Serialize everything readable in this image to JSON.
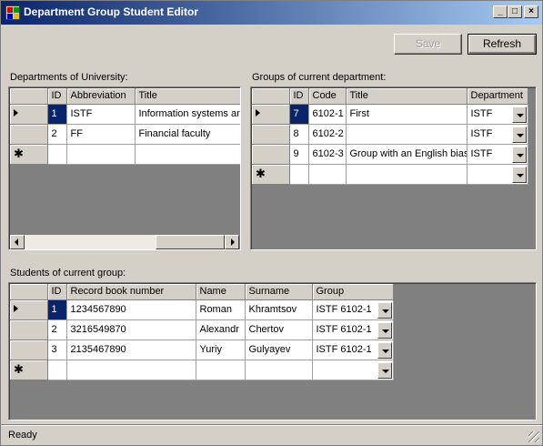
{
  "window": {
    "title": "Department Group Student Editor"
  },
  "titlebar_buttons": {
    "minimize": "_",
    "maximize": "□",
    "close": "×"
  },
  "toolbar": {
    "save_label": "Save",
    "refresh_label": "Refresh"
  },
  "departments": {
    "label": "Departments of University:",
    "columns": [
      "ID",
      "Abbreviation",
      "Title"
    ],
    "rows": [
      {
        "id": "1",
        "abbreviation": "ISTF",
        "title": "Information systems and"
      },
      {
        "id": "2",
        "abbreviation": "FF",
        "title": "Financial faculty"
      }
    ]
  },
  "groups": {
    "label": "Groups of current department:",
    "columns": [
      "ID",
      "Code",
      "Title",
      "Department"
    ],
    "rows": [
      {
        "id": "7",
        "code": "6102-1",
        "title": "First",
        "department": "ISTF"
      },
      {
        "id": "8",
        "code": "6102-2",
        "title": "",
        "department": "ISTF"
      },
      {
        "id": "9",
        "code": "6102-3",
        "title": "Group with an English bias",
        "department": "ISTF"
      }
    ]
  },
  "students": {
    "label": "Students of current group:",
    "columns": [
      "ID",
      "Record book number",
      "Name",
      "Surname",
      "Group"
    ],
    "rows": [
      {
        "id": "1",
        "record": "1234567890",
        "name": "Roman",
        "surname": "Khramtsov",
        "group": "ISTF 6102-1"
      },
      {
        "id": "2",
        "record": "3216549870",
        "name": "Alexandr",
        "surname": "Chertov",
        "group": "ISTF 6102-1"
      },
      {
        "id": "3",
        "record": "2135467890",
        "name": "Yuriy",
        "surname": "Gulyayev",
        "group": "ISTF 6102-1"
      }
    ]
  },
  "glyphs": {
    "new_row": "✱"
  },
  "status": {
    "text": "Ready"
  },
  "colors": {
    "selection": "#0a246a",
    "title_gradient_start": "#0a246a",
    "title_gradient_end": "#a6caf0",
    "window_bg": "#d4d0c8"
  }
}
